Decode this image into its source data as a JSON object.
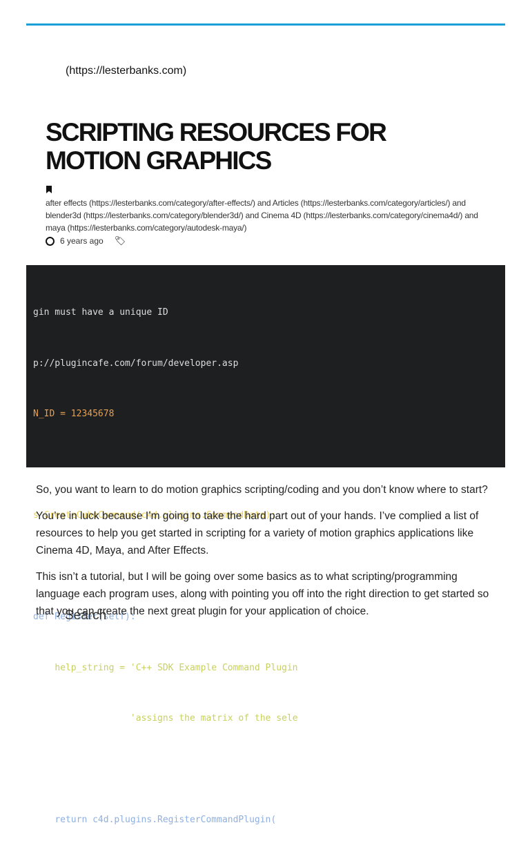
{
  "site_link": "(https://lesterbanks.com)",
  "title": "SCRIPTING RESOURCES FOR MOTION GRAPHICS",
  "categories_text": "after effects (https://lesterbanks.com/category/after-effects/) and Articles (https://lesterbanks.com/category/articles/) and blender3d (https://lesterbanks.com/category/blender3d/) and Cinema 4D (https://lesterbanks.com/category/cinema4d/) and maya (https://lesterbanks.com/category/autodesk-maya/)",
  "posted": "6 years ago",
  "hero_code": [
    "gin must have a unique ID",
    "p://plugincafe.com/forum/developer.asp",
    "N_ID = 12345678",
    "",
    "s CreateCubeCommand(c4d.plugins.CommandData):",
    "",
    "def Register(self):",
    "    help_string = 'C++ SDK Example Command Plugin",
    "                  'assigns the matrix of the sele",
    "",
    "    return c4d.plugins.RegisterCommandPlugin("
  ],
  "paragraphs": [
    "So, you want to learn to do motion graphics scripting/coding and you don’t know where to start?",
    "You’re in luck because I’m going to take the hard part out of your hands. I’ve complied a list of resources to help you get started in scripting for a variety of motion graphics applications like Cinema 4D, Maya, and After Effects.",
    "This isn’t a tutorial, but I will be going over some basics as to what scripting/programming language each program uses, along with pointing you off into the right direction to get started so that you can create the next great plugin for your application of choice."
  ],
  "search_label": "Search"
}
